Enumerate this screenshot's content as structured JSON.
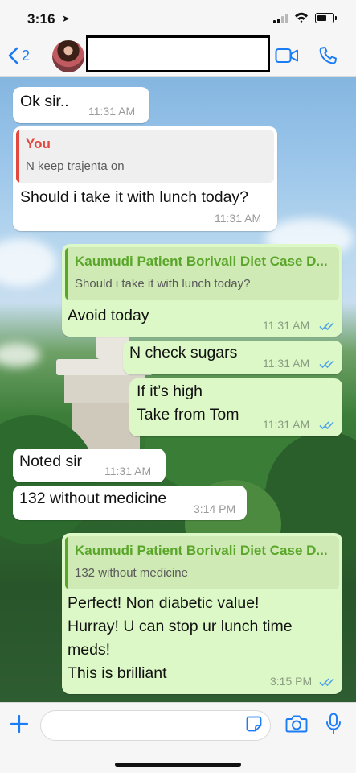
{
  "status_bar": {
    "time": "3:16",
    "location_arrow": "➤",
    "battery_level": 0.6
  },
  "header": {
    "back_count": "2",
    "contact_name": ""
  },
  "icons": {
    "back": "chevron-left-icon",
    "video": "video-camera-icon",
    "call": "phone-icon",
    "plus": "plus-icon",
    "sticker": "sticker-icon",
    "camera": "camera-icon",
    "mic": "microphone-icon"
  },
  "colors": {
    "accent": "#1b7cf6",
    "incoming_bubble": "#ffffff",
    "outgoing_bubble": "#dcf8c6",
    "quote_you": "#e2483d",
    "quote_contact": "#5aa62a",
    "read_ticks": "#4fa3e8"
  },
  "messages": [
    {
      "direction": "incoming",
      "text": "Ok sir..",
      "time": "11:31 AM"
    },
    {
      "direction": "incoming",
      "quote": {
        "author": "You",
        "text": "N keep trajenta on"
      },
      "text": "Should i take it with lunch today?",
      "time": "11:31 AM"
    },
    {
      "direction": "outgoing",
      "quote": {
        "author": "Kaumudi Patient Borivali Diet Case D...",
        "text": "Should i take it with lunch today?"
      },
      "text": "Avoid today",
      "time": "11:31 AM",
      "status": "read"
    },
    {
      "direction": "outgoing",
      "text": "N check sugars",
      "time": "11:31 AM",
      "status": "read"
    },
    {
      "direction": "outgoing",
      "lines": [
        "If it’s high",
        "Take from Tom"
      ],
      "time": "11:31 AM",
      "status": "read"
    },
    {
      "direction": "incoming",
      "text": "Noted sir",
      "time": "11:31 AM"
    },
    {
      "direction": "incoming",
      "text": "132 without medicine",
      "time": "3:14 PM"
    },
    {
      "direction": "outgoing",
      "quote": {
        "author": "Kaumudi Patient Borivali Diet Case D...",
        "text": "132 without medicine"
      },
      "lines": [
        "Perfect! Non diabetic value!",
        "Hurray! U can stop ur lunch time",
        "meds!",
        "This is brilliant"
      ],
      "time": "3:15 PM",
      "status": "read"
    }
  ],
  "composer": {
    "placeholder": ""
  }
}
